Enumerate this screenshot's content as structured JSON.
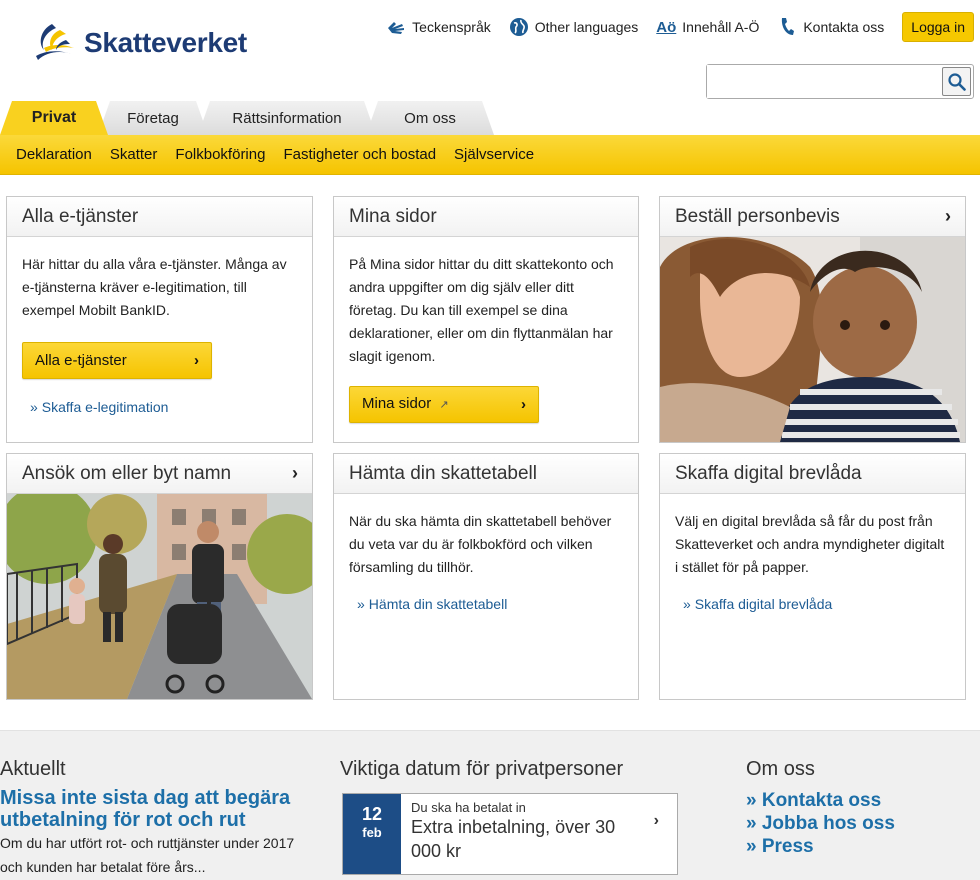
{
  "header": {
    "logo_text": "Skatteverket",
    "top_links": {
      "sign_language": "Teckenspråk",
      "other_languages": "Other languages",
      "index_icon_text": "Aö",
      "index": "Innehåll A-Ö",
      "contact": "Kontakta oss"
    },
    "login_label": "Logga in",
    "search": {
      "placeholder": "",
      "value": ""
    }
  },
  "tabs": [
    "Privat",
    "Företag",
    "Rättsinformation",
    "Om oss"
  ],
  "subnav": [
    "Deklaration",
    "Skatter",
    "Folkbokföring",
    "Fastigheter och bostad",
    "Självservice"
  ],
  "cards": {
    "etjanster": {
      "title": "Alla e-tjänster",
      "text": "Här hittar du alla våra e-tjänster. Många av e-tjänsterna kräver e-legitimation, till exempel Mobilt BankID.",
      "button": "Alla e-tjänster",
      "link": "Skaffa e-legitimation"
    },
    "mina_sidor": {
      "title": "Mina sidor",
      "text": "På Mina sidor hittar du ditt skattekonto och andra uppgifter om dig själv eller ditt företag. Du kan till exempel se dina deklarationer, eller om din flyttanmälan har slagit igenom.",
      "button": "Mina sidor"
    },
    "personbevis": {
      "title": "Beställ personbevis"
    },
    "namn": {
      "title": "Ansök om eller byt namn"
    },
    "skattetabell": {
      "title": "Hämta din skattetabell",
      "text": "När du ska hämta din skattetabell behöver du veta var du är folkbokförd och vilken församling du tillhör.",
      "link": "Hämta din skattetabell"
    },
    "brevlada": {
      "title": "Skaffa digital brevlåda",
      "text": "Välj en digital brevlåda så får du post från Skatteverket och andra myndigheter digitalt i stället för på papper.",
      "link": "Skaffa digital brevlåda"
    }
  },
  "footer": {
    "news": {
      "title": "Aktuellt",
      "headline": "Missa inte sista dag att begära utbetalning för rot och rut",
      "text": "Om du har utfört rot- och ruttjänster under 2017 och kunden har betalat före års..."
    },
    "dates": {
      "title": "Viktiga datum för privatpersoner",
      "day": "12",
      "month": "feb",
      "small": "Du ska ha betalat in",
      "main": "Extra inbetalning, över 30 000 kr"
    },
    "about": {
      "title": "Om oss",
      "links": [
        "Kontakta oss",
        "Jobba hos oss",
        "Press"
      ]
    }
  },
  "colors": {
    "brand_yellow": "#f6c800",
    "brand_blue": "#1d3b74",
    "link_blue": "#1d6fa8",
    "date_blue": "#1d4d86"
  }
}
